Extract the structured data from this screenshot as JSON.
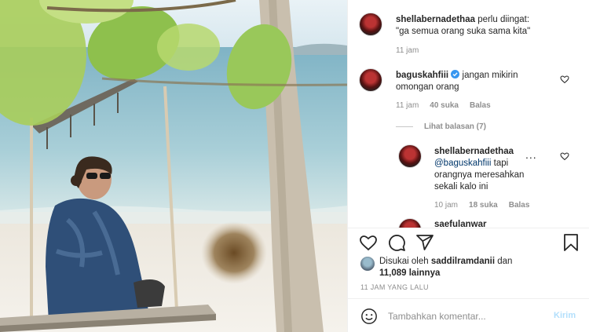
{
  "post": {
    "caption": {
      "username": "shellabernadethaa",
      "text_line1": "perlu diingat:",
      "text_line2": "\"ga semua orang suka sama kita\"",
      "age": "11 jam"
    },
    "comments": [
      {
        "username": "baguskahfiii",
        "verified": true,
        "text_line1": "jangan mikirin",
        "text_line2": "omongan orang",
        "age": "11 jam",
        "likes": "40 suka",
        "reply": "Balas",
        "view_replies": "Lihat balasan (7)"
      }
    ],
    "reply": {
      "username": "shellabernadethaa",
      "mention": "@baguskahfiii",
      "text_line1": "tapi",
      "text_line2": "orangnya meresahkan",
      "text_line3": "sekali kalo ini",
      "age": "10 jam",
      "likes": "18 suka",
      "reply": "Balas",
      "more": "..."
    },
    "partial_comment_user": "saefulanwar",
    "liked_by_prefix": "Disukai oleh",
    "liked_by_user": "saddilramdanii",
    "liked_by_and": "dan",
    "liked_by_others": "11,089 lainnya",
    "timestamp": "11 JAM YANG LALU",
    "add_comment_placeholder": "Tambahkan komentar...",
    "post_button": "Kirim"
  },
  "colors": {
    "verified": "#3897f0",
    "post_button_disabled": "#b2dffc"
  },
  "icons": [
    "heart-icon",
    "comment-icon",
    "share-icon",
    "bookmark-icon",
    "emoji-icon",
    "verified-badge-icon"
  ]
}
